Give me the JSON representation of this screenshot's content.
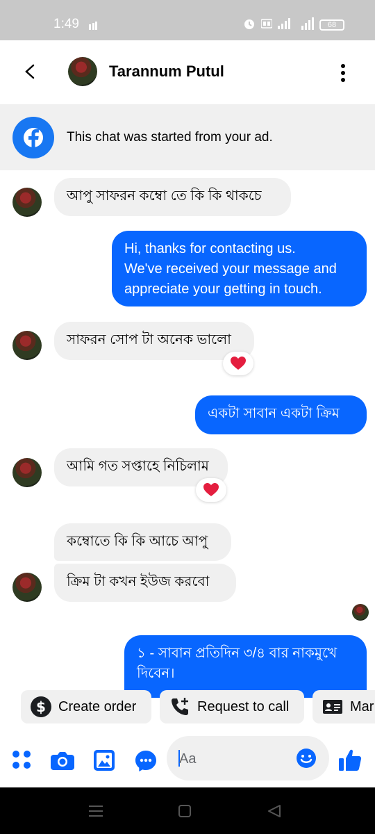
{
  "status_bar": {
    "time": "1:49",
    "battery": "68"
  },
  "header": {
    "contact_name": "Tarannum Putul"
  },
  "ad_banner": {
    "text": "This chat was started from your ad."
  },
  "messages": [
    {
      "direction": "in",
      "text": "আপু সাফরন কম্বো তে কি কি থাকচে"
    },
    {
      "direction": "out",
      "text": "Hi, thanks for contacting us.\nWe've received your message and appreciate your getting in touch."
    },
    {
      "direction": "in",
      "text": "সাফরন সোপ টা অনেক ভালো",
      "reaction": "heart"
    },
    {
      "direction": "out",
      "text": "একটা সাবান একটা ক্রিম"
    },
    {
      "direction": "in",
      "text": "আমি গত সপ্তাহে নিচিলাম",
      "reaction": "heart"
    },
    {
      "direction": "in",
      "text": "কম্বোতে কি কি আচে আপু"
    },
    {
      "direction": "in",
      "text": "ক্রিম টা কখন ইউজ করবো"
    },
    {
      "direction": "out",
      "text": "১ - সাবান প্রতিদিন ৩/৪ বার নাকমুখে দিবেন।"
    }
  ],
  "quick_actions": [
    {
      "label": "Create order",
      "icon": "dollar-icon"
    },
    {
      "label": "Request to call",
      "icon": "phone-plus-icon"
    },
    {
      "label": "Mar",
      "icon": "contact-card-icon"
    }
  ],
  "composer": {
    "placeholder": "Aa"
  },
  "colors": {
    "accent": "#0866ff",
    "incoming_bubble": "#f0f0f0",
    "facebook_blue": "#1877f2",
    "reaction_heart": "#e41e3f"
  }
}
